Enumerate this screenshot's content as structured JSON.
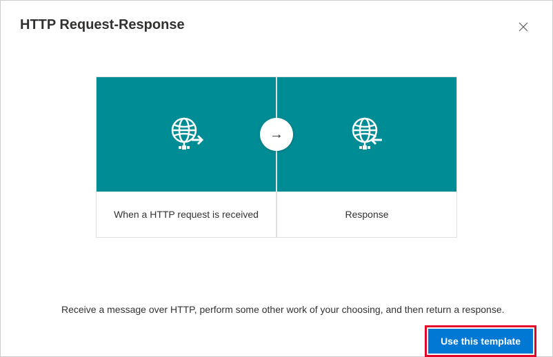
{
  "dialog": {
    "title": "HTTP Request-Response",
    "description": "Receive a message over HTTP, perform some other work of your choosing, and then return a response.",
    "use_template_label": "Use this template"
  },
  "cards": [
    {
      "label": "When a HTTP request is received",
      "icon": "http-request-icon"
    },
    {
      "label": "Response",
      "icon": "http-response-icon"
    }
  ],
  "colors": {
    "accent": "#0078d4",
    "card_hero_bg": "#008c95",
    "highlight": "#e3002b"
  }
}
